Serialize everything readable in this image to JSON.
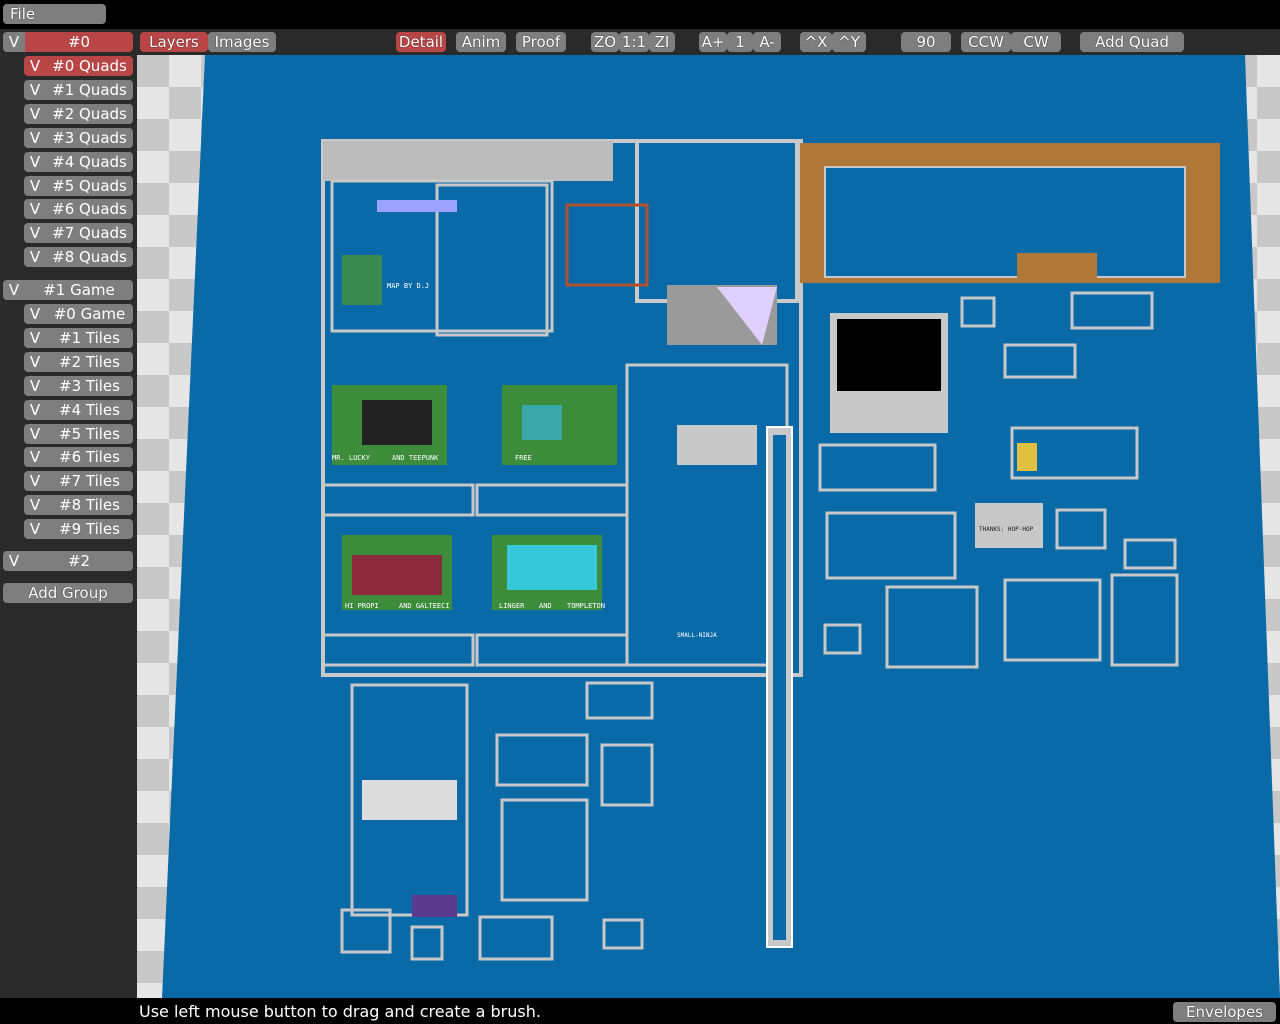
{
  "menu": {
    "file_label": "File"
  },
  "group_header": {
    "v": "V",
    "label": "#0"
  },
  "tabs": {
    "layers": "Layers",
    "images": "Images"
  },
  "toolbar": {
    "detail": "Detail",
    "anim": "Anim",
    "proof": "Proof",
    "zoom_out": "ZO",
    "zoom_reset": "1:1",
    "zoom_in": "ZI",
    "anim_faster": "A+",
    "anim_speed": "1",
    "anim_slower": "A-",
    "flip_x": "^X",
    "flip_y": "^Y",
    "rotate_angle": "90",
    "ccw": "CCW",
    "cw": "CW",
    "add_quad": "Add Quad"
  },
  "sidebar": {
    "group0_layers": [
      {
        "v": "V",
        "label": "#0 Quads",
        "selected": true
      },
      {
        "v": "V",
        "label": "#1 Quads"
      },
      {
        "v": "V",
        "label": "#2 Quads"
      },
      {
        "v": "V",
        "label": "#3 Quads"
      },
      {
        "v": "V",
        "label": "#4 Quads"
      },
      {
        "v": "V",
        "label": "#5 Quads"
      },
      {
        "v": "V",
        "label": "#6 Quads"
      },
      {
        "v": "V",
        "label": "#7 Quads"
      },
      {
        "v": "V",
        "label": "#8 Quads"
      }
    ],
    "group1": {
      "v": "V",
      "label": "#1 Game"
    },
    "group1_layers": [
      {
        "v": "V",
        "label": "#0 Game"
      },
      {
        "v": "V",
        "label": "#1 Tiles"
      },
      {
        "v": "V",
        "label": "#2 Tiles"
      },
      {
        "v": "V",
        "label": "#3 Tiles"
      },
      {
        "v": "V",
        "label": "#4 Tiles"
      },
      {
        "v": "V",
        "label": "#5 Tiles"
      },
      {
        "v": "V",
        "label": "#6 Tiles"
      },
      {
        "v": "V",
        "label": "#7 Tiles"
      },
      {
        "v": "V",
        "label": "#8 Tiles"
      },
      {
        "v": "V",
        "label": "#9 Tiles"
      }
    ],
    "group2": {
      "v": "V",
      "label": "#2"
    },
    "add_group": "Add Group"
  },
  "map_labels": {
    "l1": "MAP BY D.J",
    "l2": "MR. LUCKY",
    "l3": "AND TEEPUNK",
    "l4": "FREE",
    "l5": "HI PROPI",
    "l6": "AND GALTEECI",
    "l7": "LINGER",
    "l8": "AND",
    "l9": "TOMPLETON",
    "l10": "THANKS: HOP-HOP",
    "l11": "SMALL-NINJA"
  },
  "status": {
    "text": "Use left mouse button to drag and create a brush.",
    "envelopes": "Envelopes"
  },
  "colors": {
    "map_water": "#0a6aa8",
    "map_wall": "#c8c8c8",
    "selected": "#b94646",
    "button": "#7e7e7e",
    "sand": "#b07838"
  }
}
